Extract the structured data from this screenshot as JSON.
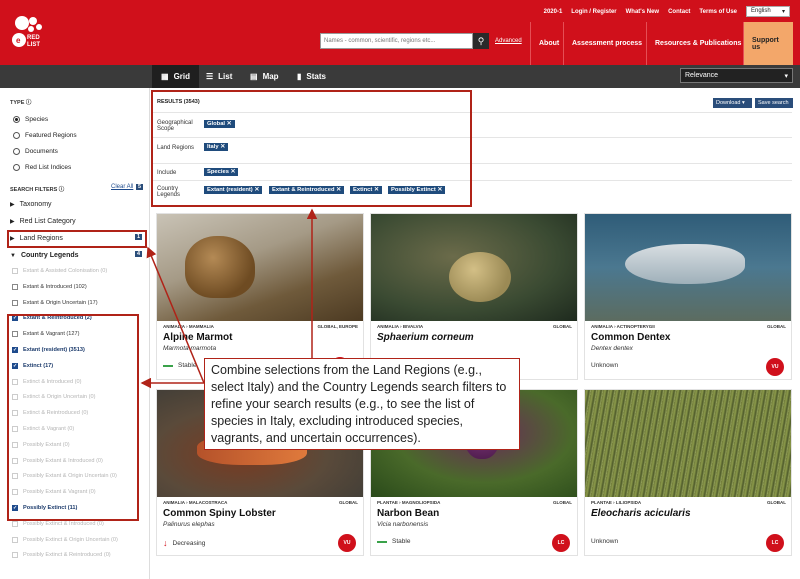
{
  "header": {
    "top_links": [
      "2020-1",
      "Login / Register",
      "What's New",
      "Contact",
      "Terms of Use"
    ],
    "language": "English",
    "logo_text": "RED LIST",
    "search_placeholder": "Names - common, scientific, regions etc...",
    "advanced": "Advanced",
    "nav": [
      "About",
      "Assessment process",
      "Resources & Publications",
      "Support us"
    ]
  },
  "views": {
    "tabs": [
      "Grid",
      "List",
      "Map",
      "Stats"
    ],
    "sort": "Relevance"
  },
  "sidebar": {
    "type_title": "TYPE",
    "types": [
      "Species",
      "Featured Regions",
      "Documents",
      "Red List Indices"
    ],
    "filters_title": "SEARCH FILTERS",
    "clear_all": "Clear All",
    "clear_count": "5",
    "filters": [
      "Taxonomy",
      "Red List Category",
      "Land Regions",
      "Country Legends"
    ],
    "land_count": "1",
    "legend_count": "4",
    "legends": [
      {
        "label": "Extant & Assisted Colonisation (0)",
        "state": "dim"
      },
      {
        "label": "Extant & Introduced (102)",
        "state": "normal"
      },
      {
        "label": "Extant & Origin Uncertain (17)",
        "state": "normal"
      },
      {
        "label": "Extant & Reintroduced (2)",
        "state": "checked"
      },
      {
        "label": "Extant & Vagrant (127)",
        "state": "normal"
      },
      {
        "label": "Extant (resident) (3513)",
        "state": "checked"
      },
      {
        "label": "Extinct (17)",
        "state": "checked"
      },
      {
        "label": "Extinct & Introduced (0)",
        "state": "dim"
      },
      {
        "label": "Extinct & Origin Uncertain (0)",
        "state": "dim"
      },
      {
        "label": "Extinct & Reintroduced (0)",
        "state": "dim"
      },
      {
        "label": "Extinct & Vagrant (0)",
        "state": "dim"
      },
      {
        "label": "Possibly Extant (0)",
        "state": "dim"
      },
      {
        "label": "Possibly Extant & Introduced (0)",
        "state": "dim"
      },
      {
        "label": "Possibly Extant & Origin Uncertain (0)",
        "state": "dim"
      },
      {
        "label": "Possibly Extant & Vagrant (0)",
        "state": "dim"
      },
      {
        "label": "Possibly Extinct (11)",
        "state": "checked"
      },
      {
        "label": "Possibly Extinct & Introduced (0)",
        "state": "dim"
      },
      {
        "label": "Possibly Extinct & Origin Uncertain (0)",
        "state": "dim"
      },
      {
        "label": "Possibly Extinct & Reintroduced (0)",
        "state": "dim"
      }
    ]
  },
  "results": {
    "count": "RESULTS (3543)",
    "download": "Download",
    "save": "Save search",
    "rows": [
      {
        "label": "Geographical Scope",
        "chips": [
          "Global"
        ]
      },
      {
        "label": "Land Regions",
        "chips": [
          "Italy"
        ]
      },
      {
        "label": "Include",
        "chips": [
          "Species"
        ]
      },
      {
        "label": "Country Legends",
        "chips": [
          "Extant (resident)",
          "Extant & Reintroduced",
          "Extinct",
          "Possibly Extinct"
        ]
      }
    ]
  },
  "cards": [
    {
      "taxon": "ANIMALIA › MAMMALIA",
      "scope": "GLOBAL, EUROPE",
      "name": "Alpine Marmot",
      "sci": "Marmota marmota",
      "trend": "Stable",
      "cat": "LC"
    },
    {
      "taxon": "ANIMALIA › BIVALVIA",
      "scope": "GLOBAL",
      "name": "Sphaerium corneum",
      "sci": "",
      "trend": "",
      "cat": ""
    },
    {
      "taxon": "ANIMALIA › ACTINOPTERYGII",
      "scope": "GLOBAL",
      "name": "Common Dentex",
      "sci": "Dentex dentex",
      "trend": "Unknown",
      "cat": "VU"
    },
    {
      "taxon": "ANIMALIA › MALACOSTRACA",
      "scope": "GLOBAL",
      "name": "Common Spiny Lobster",
      "sci": "Palinurus elephas",
      "trend": "Decreasing",
      "cat": "VU"
    },
    {
      "taxon": "PLANTAE › MAGNOLIOPSIDA",
      "scope": "GLOBAL",
      "name": "Narbon Bean",
      "sci": "Vicia narbonensis",
      "trend": "Stable",
      "cat": "LC"
    },
    {
      "taxon": "PLANTAE › LILIOPSIDA",
      "scope": "GLOBAL",
      "name": "Eleocharis acicularis",
      "sci": "",
      "trend": "Unknown",
      "cat": "LC"
    }
  ],
  "callout": "Combine selections from the Land Regions (e.g., select Italy) and the Country Legends search filters to refine your search results (e.g., to see the list of species in Italy, excluding introduced species, vagrants, and uncertain occurrences)."
}
